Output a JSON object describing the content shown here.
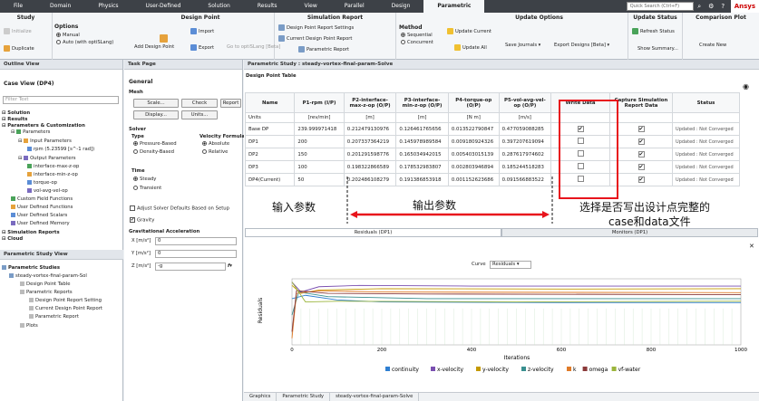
{
  "menubar": {
    "tabs": [
      "File",
      "Domain",
      "Physics",
      "User-Defined",
      "Solution",
      "Results",
      "View",
      "Parallel",
      "Design",
      "Parametric"
    ],
    "active": "Parametric",
    "search_placeholder": "Quick Search (Ctrl+F)",
    "logo": "Ansys"
  },
  "ribbon": {
    "study": {
      "title": "Study",
      "initialize": "Initialize",
      "duplicate": "Duplicate"
    },
    "options": {
      "title": "Options",
      "manual": "Manual",
      "auto": "Auto (with optiSLang)"
    },
    "design_point": {
      "title": "Design Point",
      "add": "Add Design Point",
      "import": "Import",
      "export": "Export",
      "goto": "Go to optiSLang [Beta]"
    },
    "sim_report": {
      "title": "Simulation Report",
      "settings": "Design Point Report Settings",
      "current": "Current Design Point Report",
      "parametric": "Parametric Report"
    },
    "update": {
      "title": "Update Options",
      "method": "Method",
      "sequential": "Sequential",
      "concurrent": "Concurrent",
      "update_current": "Update Current",
      "update_all": "Update All",
      "save_journals": "Save Journals",
      "export_designs": "Export Designs [Beta]"
    },
    "status": {
      "title": "Update Status",
      "refresh": "Refresh Status",
      "summary": "Show Summary..."
    },
    "compare": {
      "title": "Comparison Plot",
      "create": "Create New"
    }
  },
  "outline": {
    "title": "Outline View",
    "case_view": "Case View (DP4)",
    "filter": "Filter Text",
    "items": [
      "Solution",
      "Results",
      "Parameters & Customization",
      "Parameters",
      "Input Parameters",
      "rpm (5.23599 [s^-1 rad])",
      "Output Parameters",
      "interface-max-z-op",
      "interface-min-z-op",
      "torque-op",
      "vol-avg-vel-op",
      "Custom Field Functions",
      "User Defined Functions",
      "User Defined Scalars",
      "User Defined Memory",
      "Simulation Reports",
      "Cloud"
    ]
  },
  "param_view": {
    "title": "Parametric Study View",
    "items": [
      "Parametric Studies",
      "steady-vortex-final-param-Sol",
      "Design Point Table",
      "Parametric Reports",
      "Design Point Report Setting",
      "Current Design Point Report",
      "Parametric Report",
      "Plots"
    ]
  },
  "task": {
    "title": "Task Page",
    "general": "General",
    "mesh": "Mesh",
    "scale": "Scale...",
    "check": "Check",
    "report": "Report",
    "display": "Display...",
    "units": "Units...",
    "solver": "Solver",
    "type": "Type",
    "pressure": "Pressure-Based",
    "density": "Density-Based",
    "velform": "Velocity Formulation",
    "absolute": "Absolute",
    "relative": "Relative",
    "time": "Time",
    "steady": "Steady",
    "transient": "Transient",
    "adjust": "Adjust Solver Defaults Based on Setup",
    "gravity": "Gravity",
    "grav_title": "Gravitational Acceleration",
    "gx": "X [m/s²]",
    "gy": "Y [m/s²]",
    "gz": "Z [m/s²]",
    "gx_val": "0",
    "gy_val": "0",
    "gz_val": "-g"
  },
  "study_title": "Parametric Study : steady-vortex-final-param-Solve",
  "table": {
    "section": "Design Point Table",
    "headers": [
      "Name",
      "P1-rpm (I/P)",
      "P2-interface-max-z-op (O/P)",
      "P3-interface-min-z-op (O/P)",
      "P4-torque-op (O/P)",
      "P5-vol-avg-vel-op (O/P)",
      "Write Data",
      "Capture Simulation Report Data",
      "Status"
    ],
    "units": [
      "Units",
      "[rev/min]",
      "[m]",
      "[m]",
      "[N m]",
      "[m/s]",
      "",
      "",
      ""
    ],
    "rows": [
      {
        "name": "Base DP",
        "p1": "239.999971418",
        "p2": "0.212479130976",
        "p3": "0.126461765656",
        "p4": "0.013522790847",
        "p5": "0.477059088285",
        "wd": true,
        "cap": true,
        "status": "Updated : Not Converged"
      },
      {
        "name": "DP1",
        "p1": "200",
        "p2": "0.207337364219",
        "p3": "0.145978989584",
        "p4": "0.009180924326",
        "p5": "0.397207619094",
        "wd": false,
        "cap": true,
        "status": "Updated : Not Converged"
      },
      {
        "name": "DP2",
        "p1": "150",
        "p2": "0.201291598776",
        "p3": "0.165034942015",
        "p4": "0.005403015139",
        "p5": "0.287617974602",
        "wd": false,
        "cap": true,
        "status": "Updated : Not Converged"
      },
      {
        "name": "DP3",
        "p1": "100",
        "p2": "0.198322866589",
        "p3": "0.178532983807",
        "p4": "0.002803946894",
        "p5": "0.185244518283",
        "wd": false,
        "cap": true,
        "status": "Updated : Not Converged"
      },
      {
        "name": "DP4(Current)",
        "p1": "50",
        "p2": "0.202486108279",
        "p3": "0.191386853918",
        "p4": "0.001152623686",
        "p5": "0.091566883522",
        "wd": false,
        "cap": true,
        "status": "Updated : Not Converged"
      }
    ]
  },
  "annotations": {
    "input": "输入参数",
    "output": "输出参数",
    "write": "选择是否写出设计点完整的",
    "write2": "case和data文件"
  },
  "bottom_tabs": {
    "residuals": "Residuals (DP1)",
    "monitors": "Monitors (DP1)"
  },
  "chart_data": {
    "type": "line",
    "ylabel": "Residuals",
    "xlabel": "Iterations",
    "curve_label": "Curve",
    "curve_value": "Residuals",
    "x_ticks": [
      0,
      200,
      400,
      600,
      800,
      1000
    ],
    "xlim": [
      0,
      1000
    ],
    "series": [
      {
        "name": "continuity",
        "color": "#2f7fd1",
        "points": [
          [
            0,
            0.3
          ],
          [
            30,
            0.25
          ],
          [
            100,
            0.32
          ],
          [
            200,
            0.35
          ],
          [
            600,
            0.36
          ],
          [
            1000,
            0.36
          ]
        ]
      },
      {
        "name": "x-velocity",
        "color": "#7a4fb0",
        "points": [
          [
            0,
            0.05
          ],
          [
            20,
            0.2
          ],
          [
            60,
            0.12
          ],
          [
            150,
            0.1
          ],
          [
            400,
            0.11
          ],
          [
            1000,
            0.11
          ]
        ]
      },
      {
        "name": "y-velocity",
        "color": "#c49a00",
        "points": [
          [
            0,
            0.1
          ],
          [
            20,
            0.22
          ],
          [
            60,
            0.17
          ],
          [
            200,
            0.15
          ],
          [
            600,
            0.155
          ],
          [
            1000,
            0.15
          ]
        ]
      },
      {
        "name": "z-velocity",
        "color": "#3a8f8f",
        "points": [
          [
            0,
            0.55
          ],
          [
            15,
            0.2
          ],
          [
            80,
            0.27
          ],
          [
            300,
            0.3
          ],
          [
            1000,
            0.3
          ]
        ]
      },
      {
        "name": "k",
        "color": "#e07b28",
        "points": [
          [
            0,
            0.9
          ],
          [
            10,
            0.22
          ],
          [
            60,
            0.18
          ],
          [
            200,
            0.2
          ],
          [
            1000,
            0.21
          ]
        ]
      },
      {
        "name": "omega",
        "color": "#8b3a3a",
        "points": [
          [
            0,
            0.8
          ],
          [
            10,
            0.18
          ],
          [
            80,
            0.22
          ],
          [
            300,
            0.23
          ],
          [
            1000,
            0.24
          ]
        ]
      },
      {
        "name": "vf-water",
        "color": "#9bb53c",
        "points": [
          [
            0,
            0.05
          ],
          [
            30,
            0.35
          ],
          [
            100,
            0.34
          ],
          [
            500,
            0.35
          ],
          [
            1000,
            0.34
          ]
        ]
      }
    ]
  },
  "status_tabs": [
    "Graphics",
    "Parametric Study",
    "steady-vortex-final-param-Solve"
  ]
}
